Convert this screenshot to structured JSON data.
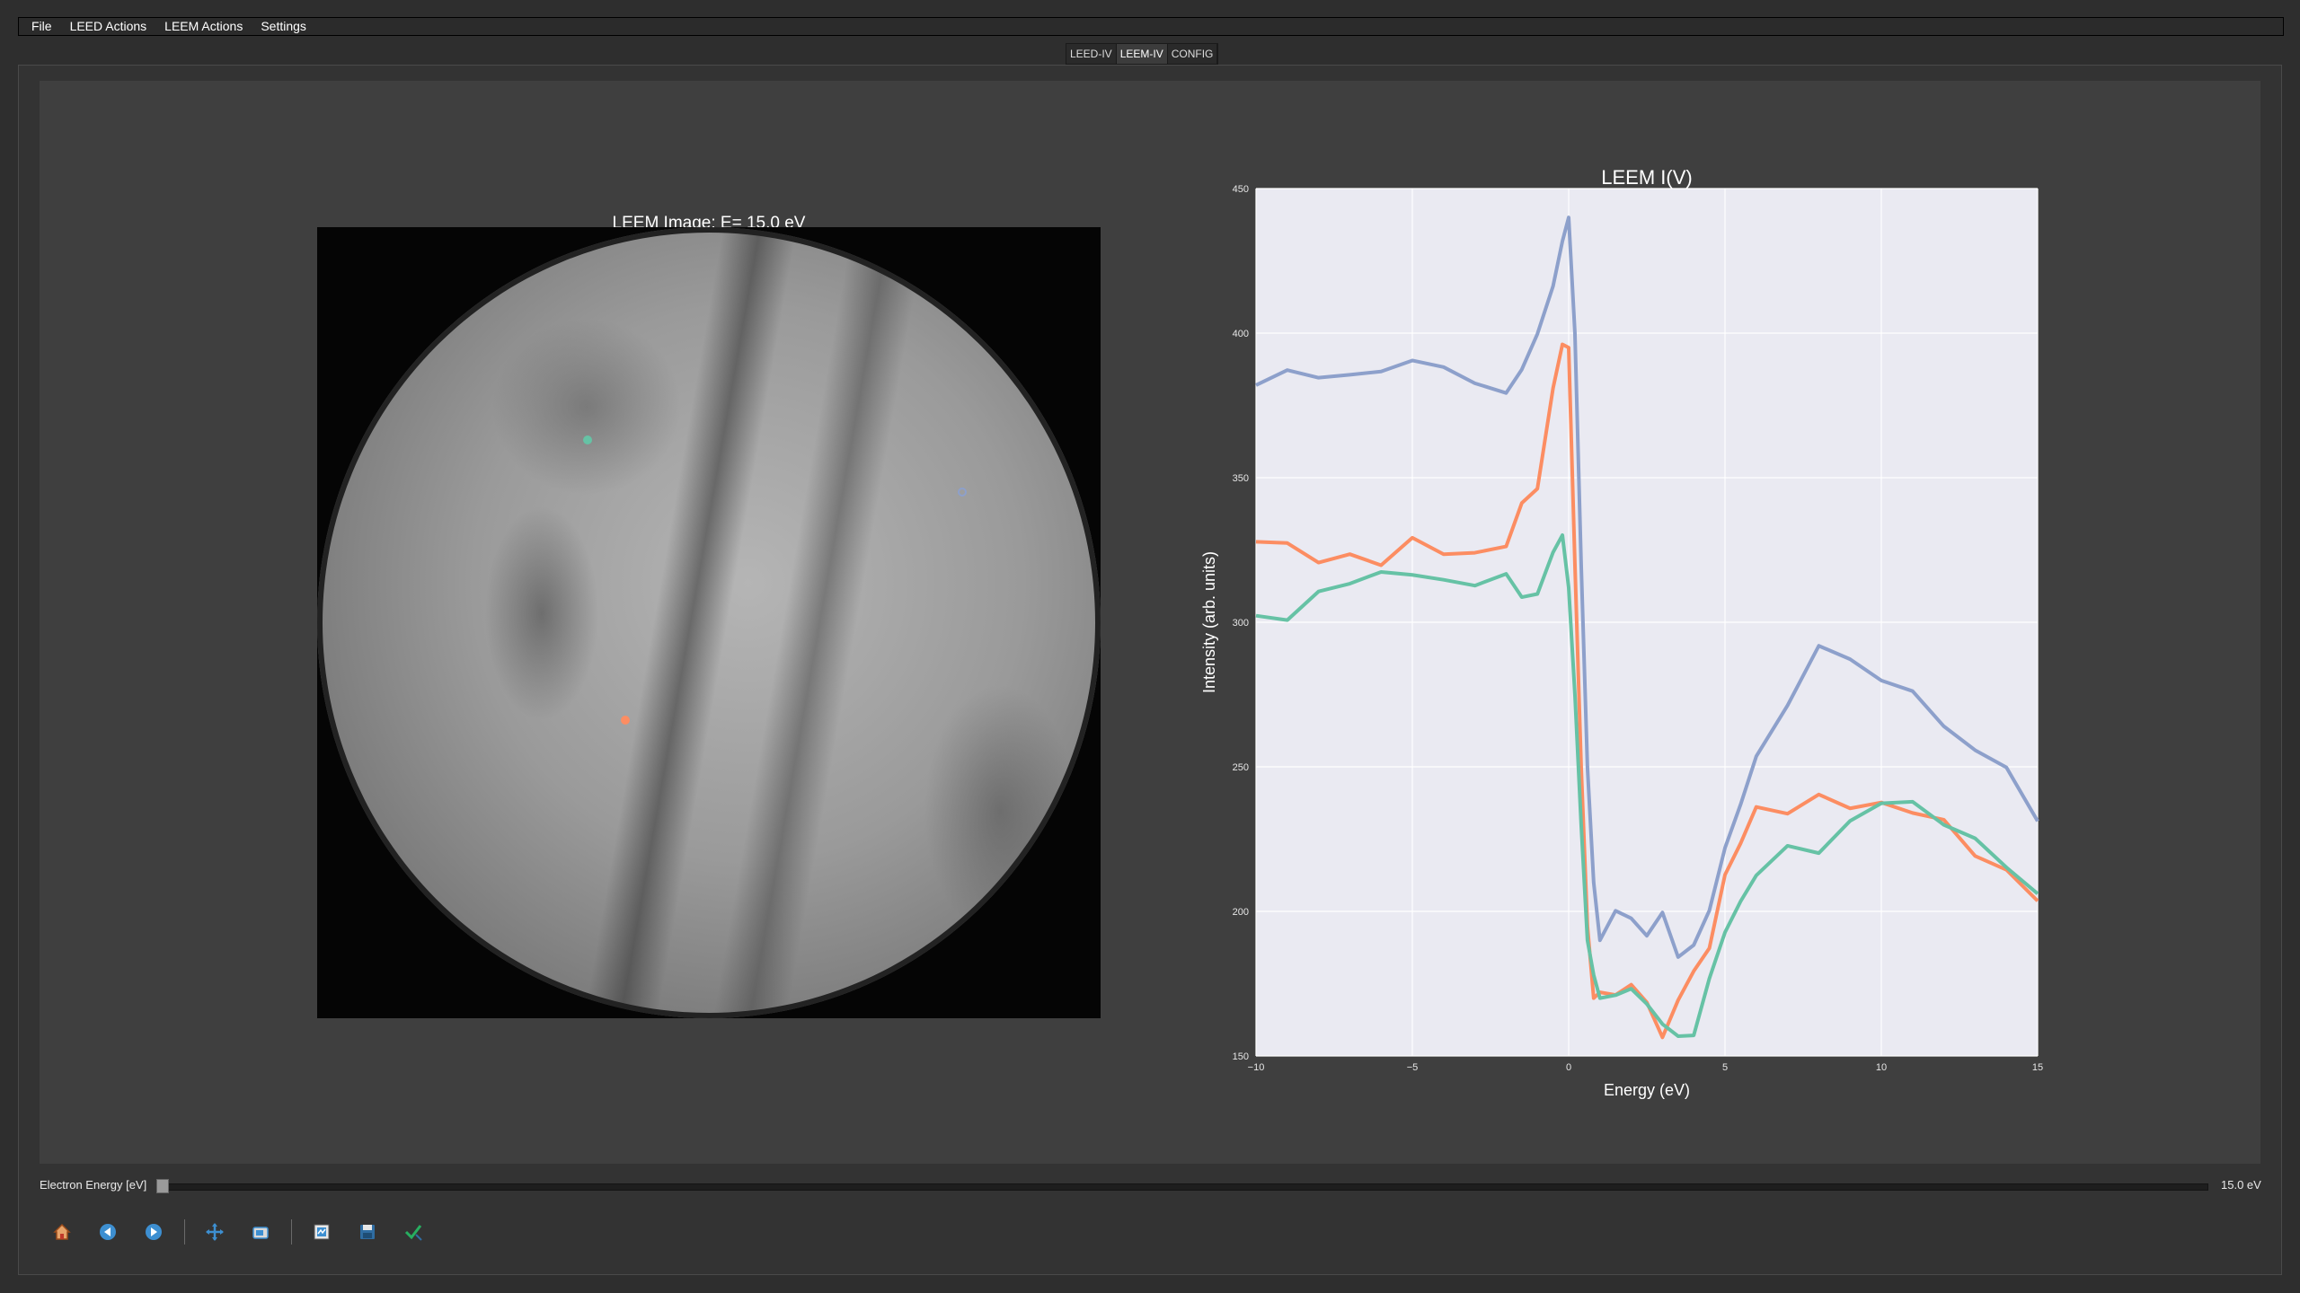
{
  "menubar": {
    "items": [
      "File",
      "LEED Actions",
      "LEEM Actions",
      "Settings"
    ]
  },
  "tabs": [
    {
      "label": "LEED-IV",
      "active": false
    },
    {
      "label": "LEEM-IV",
      "active": true
    },
    {
      "label": "CONFIG",
      "active": false
    }
  ],
  "image_panel": {
    "title": "LEEM Image: E= 15.0 eV",
    "markers": [
      {
        "name": "green-marker",
        "color": "#66c2a5"
      },
      {
        "name": "blue-marker",
        "color": "#8da0cb"
      },
      {
        "name": "orange-marker",
        "color": "#fc8d62"
      }
    ]
  },
  "controls": {
    "energy_label": "Electron Energy [eV]",
    "energy_value": "15.0 eV",
    "slider_fraction": 0.0
  },
  "toolbar": {
    "buttons": [
      {
        "icon": "home-icon"
      },
      {
        "icon": "back-arrow-icon"
      },
      {
        "icon": "forward-arrow-icon"
      },
      {
        "icon": "pan-icon"
      },
      {
        "icon": "zoom-icon"
      },
      {
        "icon": "configure-subplots-icon"
      },
      {
        "icon": "save-icon"
      },
      {
        "icon": "edit-check-icon"
      }
    ]
  },
  "chart_data": {
    "type": "line",
    "title": "LEEM I(V)",
    "xlabel": "Energy (eV)",
    "ylabel": "Intensity (arb. units)",
    "xlim": [
      -10,
      15
    ],
    "ylim": [
      150,
      450
    ],
    "xticks": [
      "-10",
      "-5",
      "0",
      "5",
      "10",
      "15"
    ],
    "yticks": [
      "150",
      "200",
      "250",
      "300",
      "350",
      "400",
      "450"
    ],
    "grid": true,
    "background": "#eaeaf2",
    "series": [
      {
        "color": "#8da0cb",
        "x": [
          -10,
          -9,
          -8,
          -7,
          -6,
          -5,
          -4,
          -3,
          -2,
          -1.5,
          -1,
          -0.5,
          -0.2,
          0,
          0.2,
          0.4,
          0.6,
          0.8,
          1,
          1.5,
          2,
          2.5,
          3,
          3.5,
          4,
          4.5,
          5,
          5.5,
          6,
          7,
          8,
          9,
          10,
          11,
          12,
          13,
          14,
          15
        ],
        "y": [
          382,
          378,
          384,
          380,
          383,
          386,
          382,
          381,
          386,
          392,
          400,
          418,
          440,
          440,
          400,
          320,
          250,
          210,
          190,
          197,
          190,
          186,
          193,
          190,
          197,
          207,
          227,
          247,
          262,
          277,
          282,
          280,
          277,
          272,
          262,
          250,
          240,
          222
        ]
      },
      {
        "color": "#fc8d62",
        "x": [
          -10,
          -9,
          -8,
          -7,
          -6,
          -5,
          -4,
          -3,
          -2,
          -1.5,
          -1,
          -0.5,
          -0.2,
          0,
          0.2,
          0.4,
          0.6,
          0.8,
          1,
          1.5,
          2,
          2.5,
          3,
          3.5,
          4,
          4.5,
          5,
          5.5,
          6,
          7,
          8,
          9,
          10,
          11,
          12,
          13,
          14,
          15
        ],
        "y": [
          326,
          330,
          325,
          329,
          327,
          331,
          326,
          329,
          331,
          336,
          346,
          375,
          390,
          395,
          320,
          250,
          195,
          170,
          172,
          174,
          176,
          170,
          166,
          163,
          170,
          185,
          205,
          222,
          227,
          232,
          237,
          240,
          244,
          240,
          236,
          228,
          218,
          204
        ]
      },
      {
        "color": "#66c2a5",
        "x": [
          -10,
          -9,
          -8,
          -7,
          -6,
          -5,
          -4,
          -3,
          -2,
          -1.5,
          -1,
          -0.5,
          -0.2,
          0,
          0.2,
          0.4,
          0.6,
          0.8,
          1,
          1.5,
          2,
          2.5,
          3,
          3.5,
          4,
          4.5,
          5,
          5.5,
          6,
          7,
          8,
          9,
          10,
          11,
          12,
          13,
          14,
          15
        ],
        "y": [
          312,
          310,
          307,
          310,
          308,
          311,
          309,
          307,
          311,
          313,
          316,
          325,
          332,
          312,
          275,
          230,
          190,
          178,
          170,
          166,
          168,
          163,
          160,
          156,
          163,
          178,
          197,
          212,
          217,
          225,
          230,
          235,
          237,
          234,
          228,
          218,
          208,
          198
        ]
      }
    ]
  }
}
